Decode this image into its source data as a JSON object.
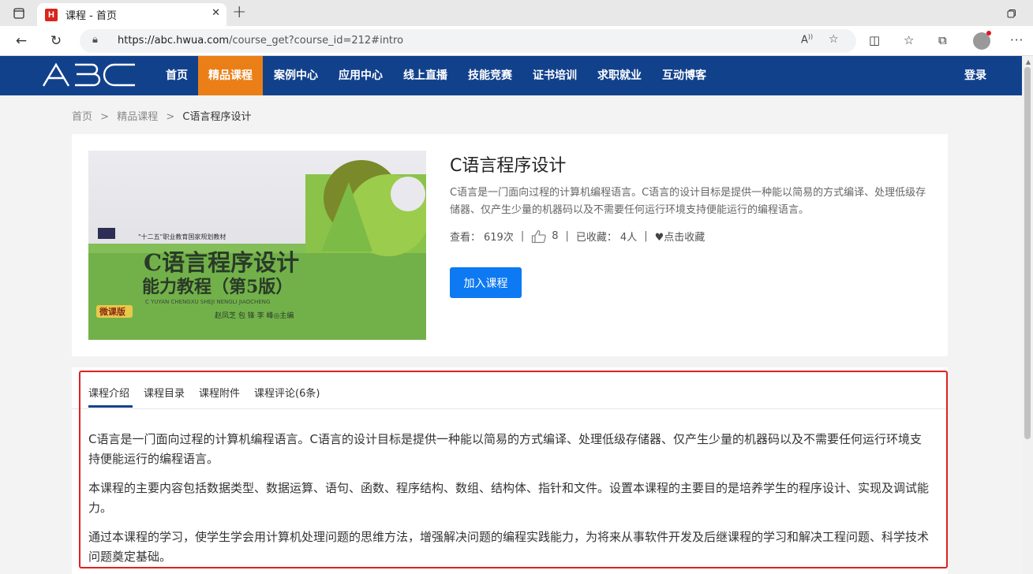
{
  "browser": {
    "tab_title": "课程 - 首页",
    "tab_favicon": "H",
    "url_host": "https://abc.hwua.com",
    "url_path": "/course_get?course_id=212#intro"
  },
  "site": {
    "logo": "ABC",
    "nav": [
      {
        "label": "首页"
      },
      {
        "label": "精品课程",
        "active": true
      },
      {
        "label": "案例中心"
      },
      {
        "label": "应用中心"
      },
      {
        "label": "线上直播"
      },
      {
        "label": "技能竞赛"
      },
      {
        "label": "证书培训"
      },
      {
        "label": "求职就业"
      },
      {
        "label": "互动博客"
      }
    ],
    "login": "登录",
    "colors": {
      "nav_bg": "#12418c",
      "nav_active": "#ea7f18",
      "primary_button": "#0d79f2",
      "highlight_border": "#e02020"
    }
  },
  "breadcrumb": {
    "items": [
      "首页",
      "精品课程",
      "C语言程序设计"
    ],
    "separator": ">"
  },
  "course": {
    "title": "C语言程序设计",
    "description": "C语言是一门面向过程的计算机编程语言。C语言的设计目标是提供一种能以简易的方式编译、处理低级存储器、仅产生少量的机器码以及不需要任何运行环境支持便能运行的编程语言。",
    "views_label": "查看：",
    "views": "619次",
    "likes": "8",
    "favorites_label": "已收藏：",
    "favorites": "4人",
    "favorite_action": "点击收藏",
    "join_button": "加入课程",
    "cover": {
      "series_label": "\"十二五\"职业教育国家规划教材",
      "title_line1": "C语言程序设计",
      "title_line2": "能力教程（第5版）",
      "pinyin": "C YUYAN CHENGXU SHEJI NENGLI JIAOCHENG",
      "authors": "赵凤芝 包 锋 李 峰◎主编",
      "edition_badge": "微课版"
    }
  },
  "detail": {
    "tabs": [
      "课程介绍",
      "课程目录",
      "课程附件",
      "课程评论(6条)"
    ],
    "active_tab": 0,
    "paragraphs": [
      "C语言是一门面向过程的计算机编程语言。C语言的设计目标是提供一种能以简易的方式编译、处理低级存储器、仅产生少量的机器码以及不需要任何运行环境支持便能运行的编程语言。",
      "本课程的主要内容包括数据类型、数据运算、语句、函数、程序结构、数组、结构体、指针和文件。设置本课程的主要目的是培养学生的程序设计、实现及调试能力。",
      "通过本课程的学习，使学生学会用计算机处理问题的思维方法，增强解决问题的编程实践能力，为将来从事软件开发及后继课程的学习和解决工程问题、科学技术问题奠定基础。"
    ]
  }
}
